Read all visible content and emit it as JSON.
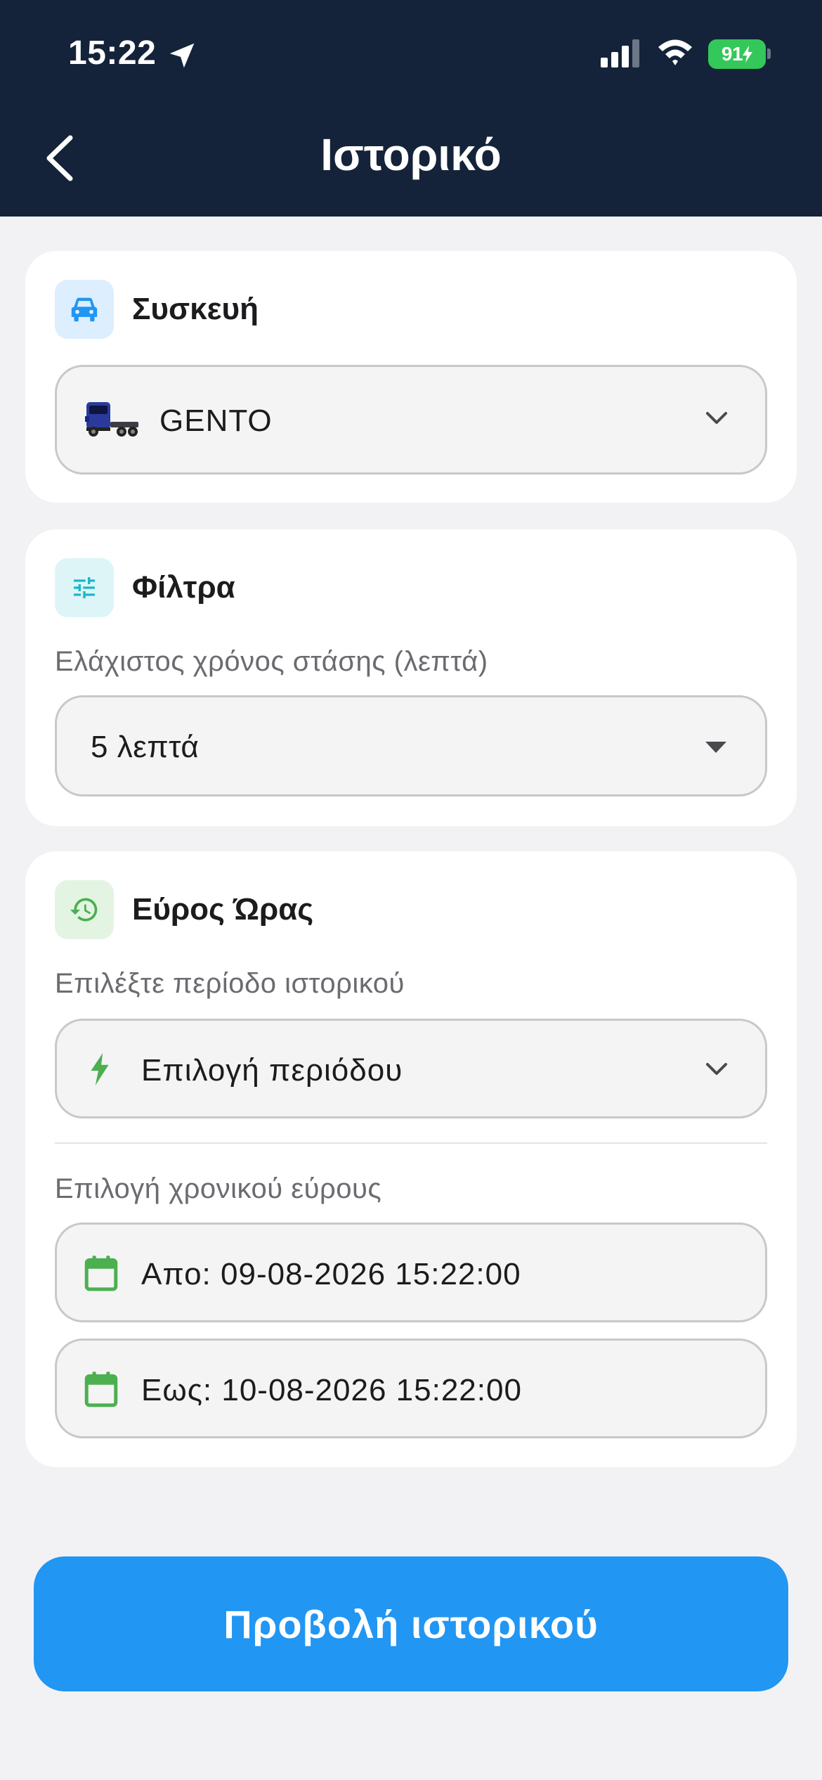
{
  "status_bar": {
    "time": "15:22",
    "battery": "91"
  },
  "nav": {
    "title": "Ιστορικό"
  },
  "device_section": {
    "title": "Συσκευή",
    "selected_device": "GENTO"
  },
  "filters_section": {
    "title": "Φίλτρα",
    "min_stop_label": "Ελάχιστος χρόνος στάσης (λεπτά)",
    "min_stop_value": "5 λεπτά"
  },
  "time_range_section": {
    "title": "Εύρος Ώρας",
    "period_label": "Επιλέξτε περίοδο ιστορικού",
    "period_value": "Επιλογή περιόδου",
    "range_label": "Επιλογή χρονικού εύρους",
    "from_value": "Απο: 09-08-2026 15:22:00",
    "to_value": "Εως: 10-08-2026 15:22:00"
  },
  "actions": {
    "view_history": "Προβολή ιστορικού"
  },
  "colors": {
    "header_bg": "#14233a",
    "primary_button": "#2196f3",
    "calendar_green": "#4caf50",
    "battery_green": "#34c759"
  }
}
